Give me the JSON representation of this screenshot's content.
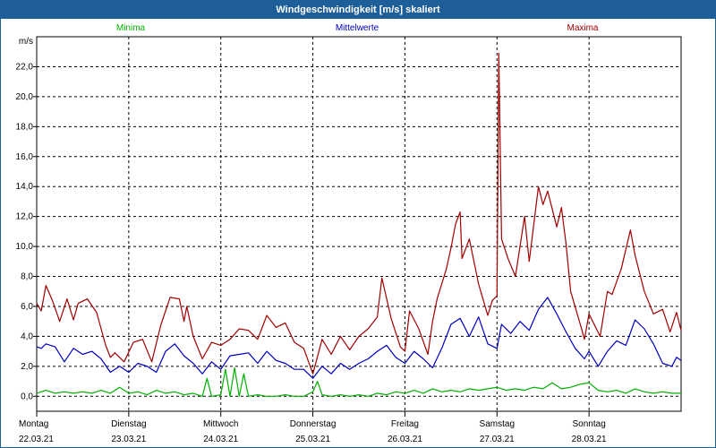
{
  "window": {
    "title": "Windgeschwindigkeit [m/s] skaliert"
  },
  "colors": {
    "min": "#00b000",
    "mean": "#0000c0",
    "max": "#a00000",
    "grid": "#000000",
    "titlebar": "#1e5f99"
  },
  "chart_data": {
    "type": "line",
    "title": "Windgeschwindigkeit [m/s] skaliert",
    "ylabel": "m/s",
    "ylim": [
      -1.0,
      24.0
    ],
    "yticks": [
      0.0,
      2.0,
      4.0,
      6.0,
      8.0,
      10.0,
      12.0,
      14.0,
      16.0,
      18.0,
      20.0,
      22.0
    ],
    "ytick_labels": [
      "0,0",
      "2,0",
      "4,0",
      "6,0",
      "8,0",
      "10,0",
      "12,0",
      "14,0",
      "16,0",
      "18,0",
      "20,0",
      "22,0"
    ],
    "xlim": [
      0,
      7
    ],
    "day_ticks": [
      {
        "x": 0,
        "day": "Montag",
        "date": "22.03.21"
      },
      {
        "x": 1,
        "day": "Dienstag",
        "date": "23.03.21"
      },
      {
        "x": 2,
        "day": "Mittwoch",
        "date": "24.03.21"
      },
      {
        "x": 3,
        "day": "Donnerstag",
        "date": "25.03.21"
      },
      {
        "x": 4,
        "day": "Freitag",
        "date": "26.03.21"
      },
      {
        "x": 5,
        "day": "Samstag",
        "date": "27.03.21"
      },
      {
        "x": 6,
        "day": "Sonntag",
        "date": "28.03.21"
      }
    ],
    "grid": true,
    "legend": [
      "Minima",
      "Mittelwerte",
      "Maxima"
    ],
    "series": [
      {
        "name": "Maxima",
        "points": [
          [
            0.0,
            6.2
          ],
          [
            0.05,
            5.7
          ],
          [
            0.1,
            7.4
          ],
          [
            0.17,
            6.4
          ],
          [
            0.25,
            5.0
          ],
          [
            0.33,
            6.5
          ],
          [
            0.4,
            5.1
          ],
          [
            0.45,
            6.2
          ],
          [
            0.55,
            6.5
          ],
          [
            0.65,
            5.6
          ],
          [
            0.75,
            3.4
          ],
          [
            0.8,
            2.6
          ],
          [
            0.85,
            2.9
          ],
          [
            0.95,
            2.3
          ],
          [
            1.05,
            3.6
          ],
          [
            1.15,
            3.8
          ],
          [
            1.25,
            2.3
          ],
          [
            1.35,
            4.8
          ],
          [
            1.45,
            6.6
          ],
          [
            1.55,
            6.5
          ],
          [
            1.6,
            5.0
          ],
          [
            1.63,
            6.0
          ],
          [
            1.7,
            4.0
          ],
          [
            1.8,
            2.5
          ],
          [
            1.9,
            3.6
          ],
          [
            2.0,
            3.4
          ],
          [
            2.1,
            3.8
          ],
          [
            2.2,
            4.5
          ],
          [
            2.3,
            4.4
          ],
          [
            2.4,
            3.8
          ],
          [
            2.5,
            5.4
          ],
          [
            2.6,
            4.6
          ],
          [
            2.7,
            4.9
          ],
          [
            2.8,
            3.6
          ],
          [
            2.9,
            3.2
          ],
          [
            3.0,
            1.5
          ],
          [
            3.1,
            3.8
          ],
          [
            3.2,
            2.8
          ],
          [
            3.3,
            4.0
          ],
          [
            3.4,
            3.1
          ],
          [
            3.5,
            4.0
          ],
          [
            3.6,
            4.5
          ],
          [
            3.7,
            5.3
          ],
          [
            3.75,
            7.9
          ],
          [
            3.85,
            5.2
          ],
          [
            3.95,
            3.3
          ],
          [
            4.0,
            3.0
          ],
          [
            4.05,
            5.7
          ],
          [
            4.15,
            4.5
          ],
          [
            4.25,
            2.8
          ],
          [
            4.3,
            5.0
          ],
          [
            4.35,
            6.5
          ],
          [
            4.45,
            8.5
          ],
          [
            4.5,
            9.9
          ],
          [
            4.55,
            11.5
          ],
          [
            4.6,
            12.3
          ],
          [
            4.62,
            9.2
          ],
          [
            4.7,
            10.5
          ],
          [
            4.8,
            7.5
          ],
          [
            4.9,
            5.4
          ],
          [
            4.95,
            6.4
          ],
          [
            5.0,
            6.7
          ],
          [
            5.02,
            22.9
          ],
          [
            5.05,
            10.5
          ],
          [
            5.12,
            9.2
          ],
          [
            5.2,
            8.0
          ],
          [
            5.3,
            12.0
          ],
          [
            5.35,
            9.0
          ],
          [
            5.45,
            14.0
          ],
          [
            5.5,
            12.8
          ],
          [
            5.55,
            13.7
          ],
          [
            5.65,
            11.3
          ],
          [
            5.7,
            12.6
          ],
          [
            5.75,
            10.2
          ],
          [
            5.8,
            7.0
          ],
          [
            5.9,
            4.9
          ],
          [
            5.95,
            3.8
          ],
          [
            6.0,
            5.5
          ],
          [
            6.12,
            4.0
          ],
          [
            6.2,
            7.0
          ],
          [
            6.25,
            6.8
          ],
          [
            6.35,
            8.5
          ],
          [
            6.45,
            11.1
          ],
          [
            6.5,
            9.4
          ],
          [
            6.6,
            7.0
          ],
          [
            6.7,
            5.5
          ],
          [
            6.8,
            5.8
          ],
          [
            6.88,
            4.3
          ],
          [
            6.95,
            5.6
          ],
          [
            7.0,
            4.4
          ]
        ]
      },
      {
        "name": "Mittelwerte",
        "points": [
          [
            0.0,
            3.3
          ],
          [
            0.05,
            3.2
          ],
          [
            0.1,
            3.5
          ],
          [
            0.2,
            3.3
          ],
          [
            0.3,
            2.3
          ],
          [
            0.4,
            3.2
          ],
          [
            0.5,
            2.8
          ],
          [
            0.6,
            3.0
          ],
          [
            0.7,
            2.5
          ],
          [
            0.8,
            1.6
          ],
          [
            0.9,
            2.0
          ],
          [
            1.0,
            1.6
          ],
          [
            1.1,
            2.2
          ],
          [
            1.2,
            2.0
          ],
          [
            1.3,
            1.6
          ],
          [
            1.4,
            3.0
          ],
          [
            1.5,
            3.5
          ],
          [
            1.6,
            2.7
          ],
          [
            1.7,
            2.2
          ],
          [
            1.8,
            1.5
          ],
          [
            1.9,
            2.3
          ],
          [
            2.0,
            1.8
          ],
          [
            2.1,
            2.7
          ],
          [
            2.2,
            2.8
          ],
          [
            2.3,
            2.9
          ],
          [
            2.4,
            2.2
          ],
          [
            2.5,
            3.0
          ],
          [
            2.6,
            2.4
          ],
          [
            2.7,
            2.2
          ],
          [
            2.8,
            1.8
          ],
          [
            2.9,
            1.8
          ],
          [
            3.0,
            1.2
          ],
          [
            3.1,
            2.0
          ],
          [
            3.2,
            1.5
          ],
          [
            3.3,
            2.2
          ],
          [
            3.4,
            1.8
          ],
          [
            3.5,
            2.2
          ],
          [
            3.6,
            2.5
          ],
          [
            3.7,
            3.0
          ],
          [
            3.8,
            3.4
          ],
          [
            3.9,
            2.6
          ],
          [
            4.0,
            2.2
          ],
          [
            4.1,
            3.0
          ],
          [
            4.2,
            2.5
          ],
          [
            4.3,
            1.9
          ],
          [
            4.4,
            3.2
          ],
          [
            4.5,
            4.8
          ],
          [
            4.6,
            5.2
          ],
          [
            4.7,
            4.0
          ],
          [
            4.8,
            5.3
          ],
          [
            4.9,
            3.5
          ],
          [
            5.0,
            3.2
          ],
          [
            5.05,
            4.8
          ],
          [
            5.15,
            4.2
          ],
          [
            5.25,
            5.0
          ],
          [
            5.35,
            4.4
          ],
          [
            5.45,
            5.8
          ],
          [
            5.55,
            6.6
          ],
          [
            5.65,
            5.5
          ],
          [
            5.75,
            4.3
          ],
          [
            5.85,
            3.2
          ],
          [
            5.95,
            2.5
          ],
          [
            6.0,
            3.0
          ],
          [
            6.1,
            2.0
          ],
          [
            6.2,
            3.0
          ],
          [
            6.3,
            3.7
          ],
          [
            6.4,
            3.4
          ],
          [
            6.5,
            5.1
          ],
          [
            6.6,
            4.5
          ],
          [
            6.7,
            3.5
          ],
          [
            6.8,
            2.2
          ],
          [
            6.9,
            2.0
          ],
          [
            6.95,
            2.6
          ],
          [
            7.0,
            2.4
          ]
        ]
      },
      {
        "name": "Minima",
        "points": [
          [
            0.0,
            0.2
          ],
          [
            0.1,
            0.4
          ],
          [
            0.2,
            0.2
          ],
          [
            0.3,
            0.3
          ],
          [
            0.4,
            0.2
          ],
          [
            0.5,
            0.3
          ],
          [
            0.6,
            0.2
          ],
          [
            0.7,
            0.4
          ],
          [
            0.8,
            0.2
          ],
          [
            0.9,
            0.6
          ],
          [
            1.0,
            0.2
          ],
          [
            1.1,
            0.3
          ],
          [
            1.2,
            0.1
          ],
          [
            1.3,
            0.4
          ],
          [
            1.4,
            0.2
          ],
          [
            1.5,
            0.3
          ],
          [
            1.6,
            0.1
          ],
          [
            1.7,
            0.2
          ],
          [
            1.8,
            0.0
          ],
          [
            1.85,
            1.2
          ],
          [
            1.9,
            0.0
          ],
          [
            2.0,
            0.1
          ],
          [
            2.05,
            1.8
          ],
          [
            2.1,
            0.0
          ],
          [
            2.15,
            1.9
          ],
          [
            2.2,
            0.0
          ],
          [
            2.25,
            1.5
          ],
          [
            2.3,
            0.0
          ],
          [
            2.4,
            0.1
          ],
          [
            2.5,
            0.0
          ],
          [
            2.6,
            0.0
          ],
          [
            2.7,
            0.1
          ],
          [
            2.8,
            0.0
          ],
          [
            2.9,
            0.0
          ],
          [
            3.0,
            0.3
          ],
          [
            3.05,
            1.0
          ],
          [
            3.1,
            0.1
          ],
          [
            3.2,
            0.0
          ],
          [
            3.3,
            0.1
          ],
          [
            3.4,
            0.0
          ],
          [
            3.5,
            0.1
          ],
          [
            3.6,
            0.0
          ],
          [
            3.7,
            0.2
          ],
          [
            3.8,
            0.1
          ],
          [
            3.9,
            0.3
          ],
          [
            4.0,
            0.2
          ],
          [
            4.1,
            0.4
          ],
          [
            4.2,
            0.2
          ],
          [
            4.3,
            0.5
          ],
          [
            4.4,
            0.3
          ],
          [
            4.5,
            0.4
          ],
          [
            4.6,
            0.3
          ],
          [
            4.7,
            0.5
          ],
          [
            4.8,
            0.4
          ],
          [
            4.9,
            0.5
          ],
          [
            5.0,
            0.6
          ],
          [
            5.1,
            0.4
          ],
          [
            5.2,
            0.5
          ],
          [
            5.3,
            0.4
          ],
          [
            5.4,
            0.6
          ],
          [
            5.5,
            0.5
          ],
          [
            5.6,
            0.9
          ],
          [
            5.7,
            0.5
          ],
          [
            5.8,
            0.6
          ],
          [
            5.9,
            0.8
          ],
          [
            6.0,
            0.9
          ],
          [
            6.1,
            0.4
          ],
          [
            6.2,
            0.3
          ],
          [
            6.3,
            0.4
          ],
          [
            6.4,
            0.2
          ],
          [
            6.5,
            0.5
          ],
          [
            6.6,
            0.3
          ],
          [
            6.7,
            0.2
          ],
          [
            6.8,
            0.3
          ],
          [
            6.9,
            0.2
          ],
          [
            7.0,
            0.2
          ]
        ]
      }
    ]
  }
}
